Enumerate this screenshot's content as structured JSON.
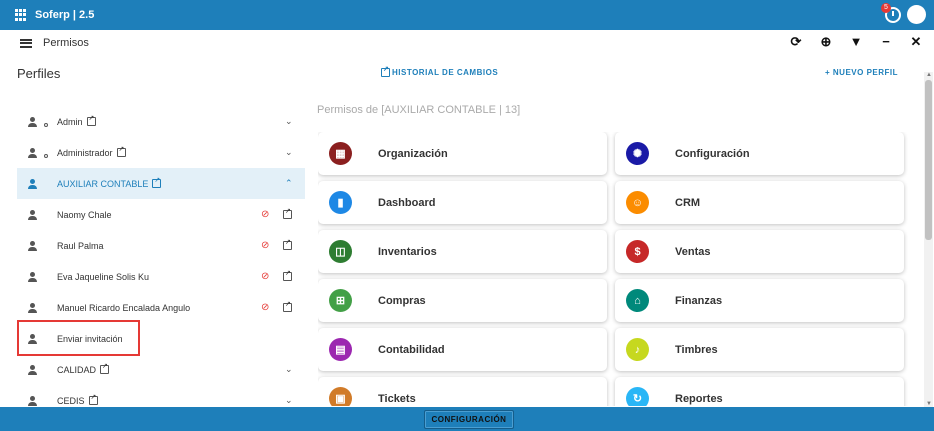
{
  "app": {
    "brand": "Soferp | 2.5",
    "notification_count": "5"
  },
  "appbar": {
    "title": "Permisos"
  },
  "perfiles": {
    "heading": "Perfiles",
    "historial_label": "HISTORIAL DE CAMBIOS",
    "nuevo_label": "+ NUEVO PERFIL"
  },
  "sidebar": {
    "items": [
      {
        "label": "Admin",
        "type": "group"
      },
      {
        "label": "Administrador",
        "type": "group"
      },
      {
        "label": "AUXILIAR CONTABLE",
        "type": "group-selected"
      },
      {
        "label": "Naomy Chale",
        "type": "user"
      },
      {
        "label": "Raul Palma",
        "type": "user"
      },
      {
        "label": "Eva Jaqueline Solis Ku",
        "type": "user"
      },
      {
        "label": "Manuel Ricardo Encalada Angulo",
        "type": "user"
      },
      {
        "label": "Enviar invitación",
        "type": "invite"
      },
      {
        "label": "CALIDAD",
        "type": "group"
      },
      {
        "label": "CEDIS",
        "type": "group"
      }
    ]
  },
  "permisos": {
    "heading": "Permisos de [AUXILIAR CONTABLE | 13]",
    "modules": [
      {
        "label": "Organización",
        "color": "#8b1f1f",
        "icon": "building-icon"
      },
      {
        "label": "Configuración",
        "color": "#1a1aa6",
        "icon": "gear-icon"
      },
      {
        "label": "Dashboard",
        "color": "#1e88e5",
        "icon": "bar-chart-icon"
      },
      {
        "label": "CRM",
        "color": "#fb8c00",
        "icon": "person-icon"
      },
      {
        "label": "Inventarios",
        "color": "#2e7d32",
        "icon": "box-icon"
      },
      {
        "label": "Ventas",
        "color": "#c62828",
        "icon": "price-tag-icon"
      },
      {
        "label": "Compras",
        "color": "#43a047",
        "icon": "cart-icon"
      },
      {
        "label": "Finanzas",
        "color": "#00897b",
        "icon": "bank-icon"
      },
      {
        "label": "Contabilidad",
        "color": "#9c27b0",
        "icon": "ledger-icon"
      },
      {
        "label": "Timbres",
        "color": "#c6d81f",
        "icon": "bell-icon"
      },
      {
        "label": "Tickets",
        "color": "#d17b28",
        "icon": "ticket-icon"
      },
      {
        "label": "Reportes",
        "color": "#29b6f6",
        "icon": "report-icon"
      }
    ]
  },
  "footer": {
    "config_label": "CONFIGURACIÓN"
  }
}
